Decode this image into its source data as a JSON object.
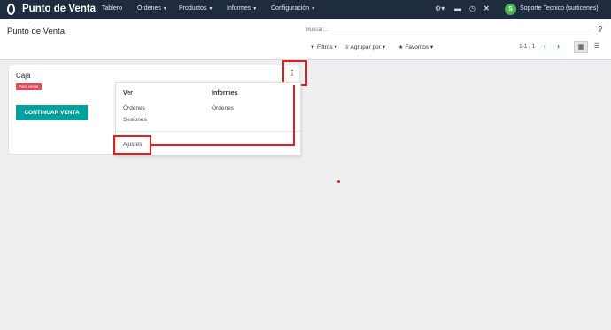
{
  "navbar": {
    "app_title": "Punto de Venta",
    "menus": [
      "Tablero",
      "Órdenes",
      "Productos",
      "Informes",
      "Configuración"
    ],
    "user_initial": "S",
    "user_name": "Soporte Tecnico (surticenes)"
  },
  "control_panel": {
    "breadcrumb": "Punto de Venta",
    "search_placeholder": "Buscar...",
    "filters": "Filtros",
    "group_by": "Agrupar por",
    "favorites": "Favoritos",
    "pager": "1-1 / 1"
  },
  "card": {
    "title": "Caja",
    "badge": "Para cerrar",
    "continue_button": "CONTINUAR VENTA",
    "kebab": "⋮"
  },
  "dropdown": {
    "view_header": "Ver",
    "view_items": [
      "Órdenes",
      "Sesiones"
    ],
    "reports_header": "Informes",
    "reports_items": [
      "Órdenes"
    ],
    "settings": "Ajustes"
  },
  "colors": {
    "navbar": "#1f2b3e",
    "accent": "#00a09d",
    "badge": "#dc4a5c",
    "highlight": "#e02020"
  }
}
